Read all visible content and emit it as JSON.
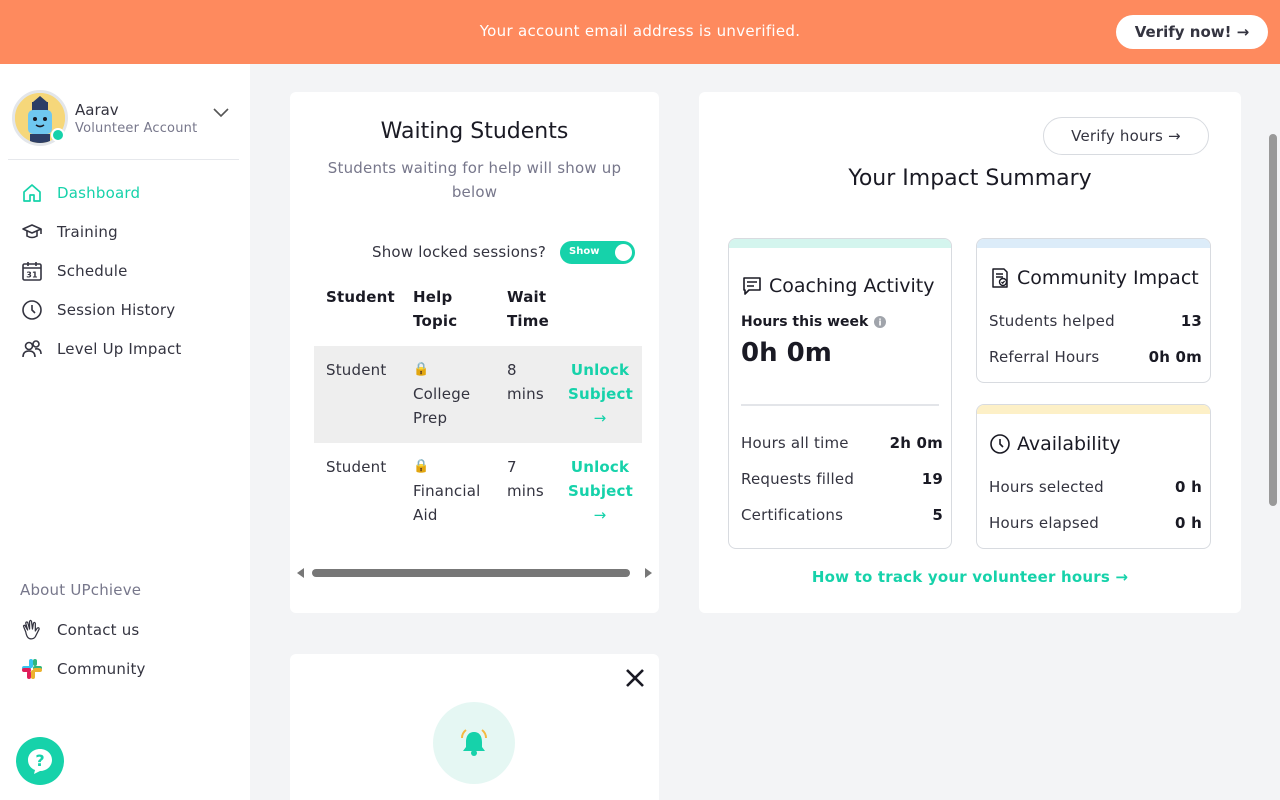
{
  "banner": {
    "message": "Your account email address is unverified.",
    "cta": "Verify now! →"
  },
  "profile": {
    "name": "Aarav",
    "role": "Volunteer Account"
  },
  "nav": {
    "items": [
      {
        "label": "Dashboard",
        "icon": "home-icon",
        "active": true
      },
      {
        "label": "Training",
        "icon": "graduation-cap-icon"
      },
      {
        "label": "Schedule",
        "icon": "calendar-icon"
      },
      {
        "label": "Session History",
        "icon": "clock-icon"
      },
      {
        "label": "Level Up Impact",
        "icon": "people-icon"
      }
    ],
    "about_label": "About UPchieve",
    "footer_items": [
      {
        "label": "Contact us",
        "icon": "waving-hand-icon"
      },
      {
        "label": "Community",
        "icon": "slack-icon"
      }
    ]
  },
  "waiting": {
    "title": "Waiting Students",
    "subtitle": "Students waiting for help will show up below",
    "toggle_label": "Show locked sessions?",
    "toggle_text": "Show",
    "headers": {
      "student": "Student",
      "topic_1": "Help",
      "topic_2": "Topic",
      "wait_1": "Wait",
      "wait_2": "Time"
    },
    "rows": [
      {
        "student": "Student",
        "lock": "🔒",
        "topic_1": "College",
        "topic_2": "Prep",
        "wait_1": "8",
        "wait_2": "mins",
        "action_1": "Unlock",
        "action_2": "Subject",
        "arrow": "→"
      },
      {
        "student": "Student",
        "lock": "🔒",
        "topic_1": "Financial",
        "topic_2": "Aid",
        "wait_1": "7",
        "wait_2": "mins",
        "action_1": "Unlock",
        "action_2": "Subject",
        "arrow": "→"
      }
    ]
  },
  "impact": {
    "verify_hours": "Verify hours →",
    "title": "Your Impact Summary",
    "coaching": {
      "title": "Coaching Activity",
      "week_label": "Hours this week",
      "week_value": "0h 0m",
      "rows": [
        {
          "label": "Hours all time",
          "value": "2h 0m"
        },
        {
          "label": "Requests filled",
          "value": "19"
        },
        {
          "label": "Certifications",
          "value": "5"
        }
      ]
    },
    "community": {
      "title": "Community Impact",
      "rows": [
        {
          "label": "Students helped",
          "value": "13"
        },
        {
          "label": "Referral Hours",
          "value": "0h 0m"
        }
      ]
    },
    "availability": {
      "title": "Availability",
      "rows": [
        {
          "label": "Hours selected",
          "value": "0 h"
        },
        {
          "label": "Hours elapsed",
          "value": "0 h"
        }
      ]
    },
    "track_link": "How to track your volunteer hours →"
  },
  "colors": {
    "banner": "#fe8a5e",
    "accent": "#16d2aa",
    "coaching_bar": "#d4f5ee",
    "community_bar": "#dcecf9",
    "availability_bar": "#fdf0c7"
  }
}
